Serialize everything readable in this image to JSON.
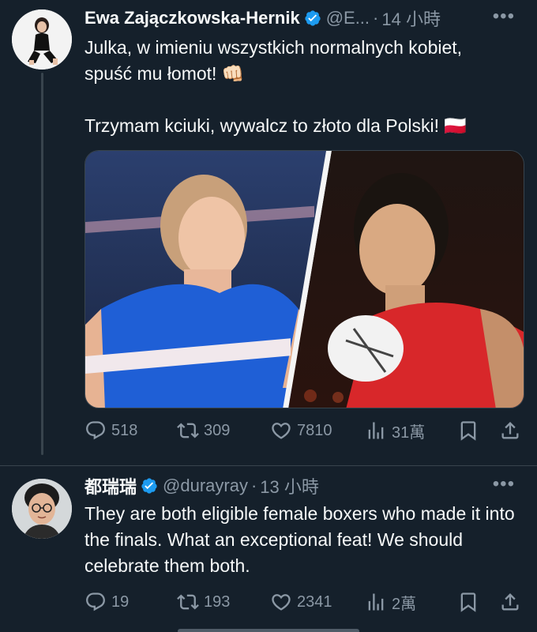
{
  "tweets": [
    {
      "name": "Ewa Zajączkowska-Hernik",
      "handle": "@E...",
      "time": "14 小時",
      "text": "Julka, w imieniu wszystkich normalnych kobiet,\nspuść mu łomot! 👊🏻\n\nTrzymam kciuki, wywalcz to złoto dla Polski! 🇵🇱",
      "replies": "518",
      "retweets": "309",
      "likes": "7810",
      "views": "31萬"
    },
    {
      "name": "都瑞瑞",
      "handle": "@durayray",
      "time": "13 小時",
      "text": "They are both eligible female boxers who made it into the finals. What an exceptional feat! We should celebrate them both.",
      "replies": "19",
      "retweets": "193",
      "likes": "2341",
      "views": "2萬"
    }
  ],
  "icons": {
    "verified": "verified-badge-icon",
    "more": "more-icon",
    "reply": "reply-icon",
    "retweet": "retweet-icon",
    "like": "heart-icon",
    "views": "views-icon",
    "bookmark": "bookmark-icon",
    "share": "share-icon"
  },
  "colors": {
    "background": "#15202b",
    "text": "#f7f9f9",
    "secondary": "#8b98a5",
    "verified": "#1d9bf0",
    "divider": "#38444d"
  }
}
